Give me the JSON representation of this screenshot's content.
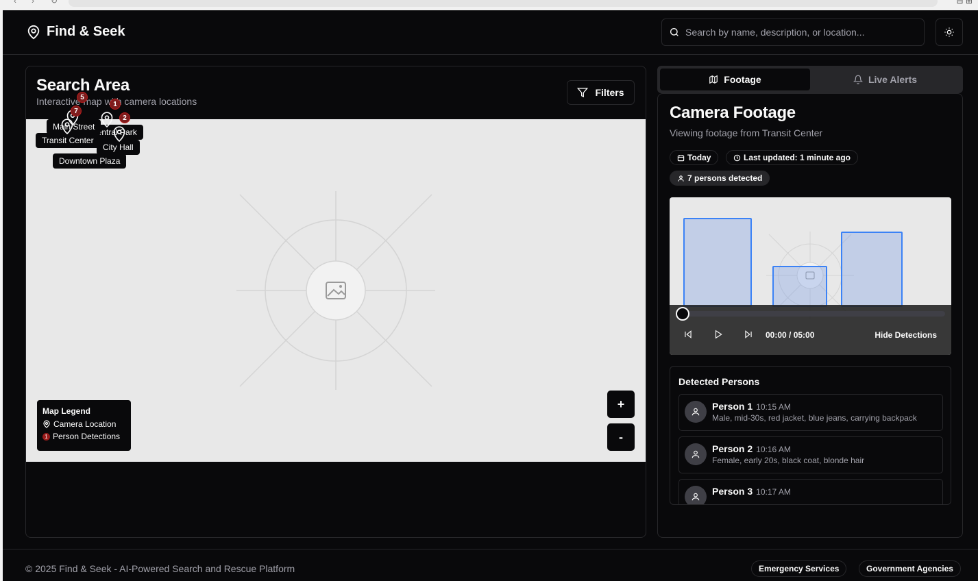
{
  "app": {
    "name": "Find & Seek"
  },
  "search": {
    "placeholder": "Search by name, description, or location..."
  },
  "map_card": {
    "title": "Search Area",
    "subtitle": "Interactive map with camera locations",
    "filters_label": "Filters",
    "locations": [
      {
        "name": "Main Street",
        "detections": "7"
      },
      {
        "name": "Transit Center",
        "detections": "5"
      },
      {
        "name": "Central Park",
        "detections": "1"
      },
      {
        "name": "City Hall",
        "detections": "2"
      },
      {
        "name": "Downtown Plaza",
        "detections": ""
      }
    ],
    "legend": {
      "title": "Map Legend",
      "camera": "Camera Location",
      "person": "Person Detections",
      "badge": "1"
    },
    "zoom_in": "+",
    "zoom_out": "-"
  },
  "tabs": {
    "footage": "Footage",
    "alerts": "Live Alerts"
  },
  "footage": {
    "title": "Camera Footage",
    "subtitle": "Viewing footage from Transit Center",
    "chip_date": "Today",
    "chip_updated": "Last updated: 1 minute ago",
    "chip_persons": "7 persons detected",
    "time": "00:00 / 05:00",
    "hide_detections": "Hide Detections",
    "progress": 0
  },
  "persons": {
    "title": "Detected Persons",
    "items": [
      {
        "name": "Person 1",
        "time": "10:15 AM",
        "desc": "Male, mid-30s, red jacket, blue jeans, carrying backpack"
      },
      {
        "name": "Person 2",
        "time": "10:16 AM",
        "desc": "Female, early 20s, black coat, blonde hair"
      },
      {
        "name": "Person 3",
        "time": "10:17 AM",
        "desc": ""
      }
    ]
  },
  "footer": {
    "copyright": "© 2025 Find & Seek - AI-Powered Search and Rescue Platform",
    "emergency": "Emergency Services",
    "government": "Government Agencies"
  },
  "colors": {
    "background": "#09090b",
    "border": "#27272a",
    "muted": "#a1a1aa",
    "detection_badge": "#7f1d1d",
    "bbox": "#3b82f6"
  }
}
